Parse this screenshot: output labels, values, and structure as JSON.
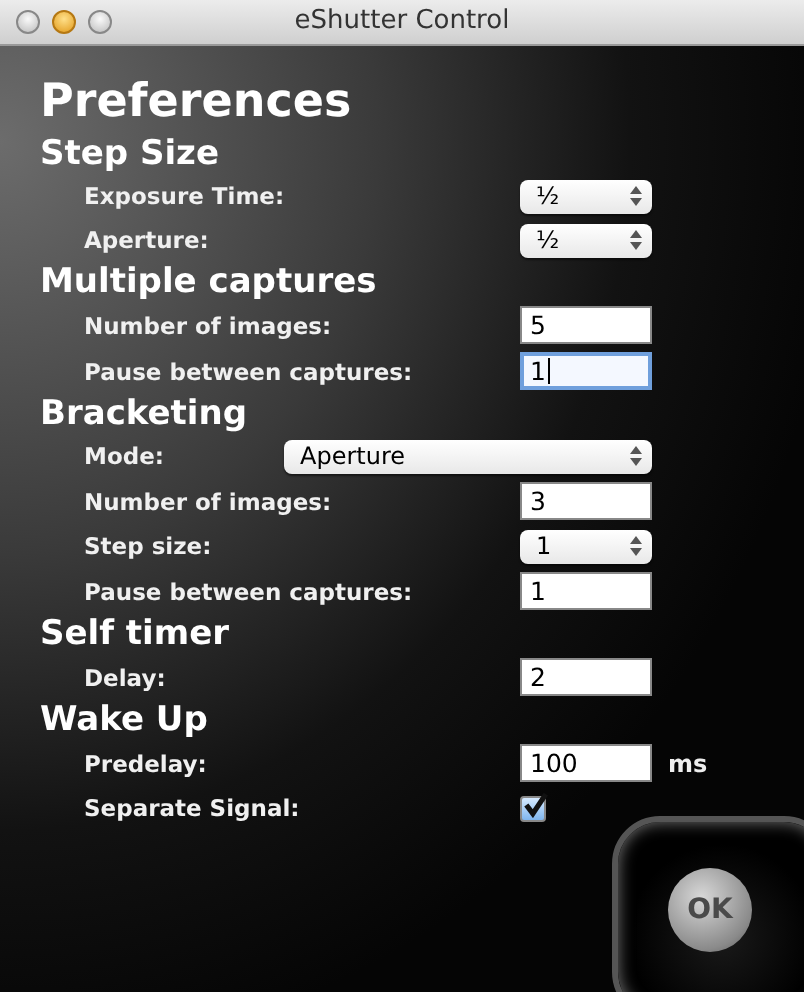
{
  "window": {
    "title": "eShutter Control"
  },
  "heading": "Preferences",
  "sections": [
    {
      "title": "Step Size",
      "rows": [
        {
          "label": "Exposure Time:",
          "kind": "select",
          "value": "½"
        },
        {
          "label": "Aperture:",
          "kind": "select",
          "value": "½"
        }
      ]
    },
    {
      "title": "Multiple captures",
      "rows": [
        {
          "label": "Number of images:",
          "kind": "text",
          "value": "5",
          "focused": false
        },
        {
          "label": "Pause between captures:",
          "kind": "text",
          "value": "1",
          "focused": true
        }
      ]
    },
    {
      "title": "Bracketing",
      "rows": [
        {
          "label": "Mode:",
          "kind": "wide-select",
          "value": "Aperture"
        },
        {
          "label": "Number of images:",
          "kind": "text",
          "value": "3",
          "focused": false
        },
        {
          "label": "Step size:",
          "kind": "select",
          "value": "1"
        },
        {
          "label": "Pause between captures:",
          "kind": "text",
          "value": "1",
          "focused": false
        }
      ]
    },
    {
      "title": "Self timer",
      "rows": [
        {
          "label": "Delay:",
          "kind": "text",
          "value": "2",
          "focused": false
        }
      ]
    },
    {
      "title": "Wake Up",
      "rows": [
        {
          "label": "Predelay:",
          "kind": "text",
          "value": "100",
          "focused": false,
          "unit": "ms"
        },
        {
          "label": "Separate Signal:",
          "kind": "checkbox",
          "checked": true
        }
      ]
    }
  ],
  "ok_button": "OK"
}
